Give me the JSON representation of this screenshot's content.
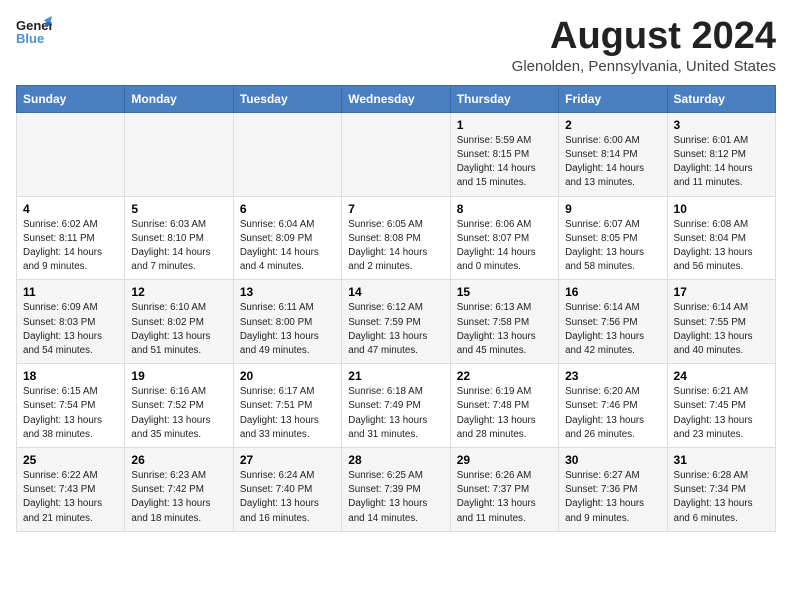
{
  "header": {
    "logo_line1": "General",
    "logo_line2": "Blue",
    "month": "August 2024",
    "location": "Glenolden, Pennsylvania, United States"
  },
  "weekdays": [
    "Sunday",
    "Monday",
    "Tuesday",
    "Wednesday",
    "Thursday",
    "Friday",
    "Saturday"
  ],
  "weeks": [
    [
      {
        "day": "",
        "info": ""
      },
      {
        "day": "",
        "info": ""
      },
      {
        "day": "",
        "info": ""
      },
      {
        "day": "",
        "info": ""
      },
      {
        "day": "1",
        "info": "Sunrise: 5:59 AM\nSunset: 8:15 PM\nDaylight: 14 hours\nand 15 minutes."
      },
      {
        "day": "2",
        "info": "Sunrise: 6:00 AM\nSunset: 8:14 PM\nDaylight: 14 hours\nand 13 minutes."
      },
      {
        "day": "3",
        "info": "Sunrise: 6:01 AM\nSunset: 8:12 PM\nDaylight: 14 hours\nand 11 minutes."
      }
    ],
    [
      {
        "day": "4",
        "info": "Sunrise: 6:02 AM\nSunset: 8:11 PM\nDaylight: 14 hours\nand 9 minutes."
      },
      {
        "day": "5",
        "info": "Sunrise: 6:03 AM\nSunset: 8:10 PM\nDaylight: 14 hours\nand 7 minutes."
      },
      {
        "day": "6",
        "info": "Sunrise: 6:04 AM\nSunset: 8:09 PM\nDaylight: 14 hours\nand 4 minutes."
      },
      {
        "day": "7",
        "info": "Sunrise: 6:05 AM\nSunset: 8:08 PM\nDaylight: 14 hours\nand 2 minutes."
      },
      {
        "day": "8",
        "info": "Sunrise: 6:06 AM\nSunset: 8:07 PM\nDaylight: 14 hours\nand 0 minutes."
      },
      {
        "day": "9",
        "info": "Sunrise: 6:07 AM\nSunset: 8:05 PM\nDaylight: 13 hours\nand 58 minutes."
      },
      {
        "day": "10",
        "info": "Sunrise: 6:08 AM\nSunset: 8:04 PM\nDaylight: 13 hours\nand 56 minutes."
      }
    ],
    [
      {
        "day": "11",
        "info": "Sunrise: 6:09 AM\nSunset: 8:03 PM\nDaylight: 13 hours\nand 54 minutes."
      },
      {
        "day": "12",
        "info": "Sunrise: 6:10 AM\nSunset: 8:02 PM\nDaylight: 13 hours\nand 51 minutes."
      },
      {
        "day": "13",
        "info": "Sunrise: 6:11 AM\nSunset: 8:00 PM\nDaylight: 13 hours\nand 49 minutes."
      },
      {
        "day": "14",
        "info": "Sunrise: 6:12 AM\nSunset: 7:59 PM\nDaylight: 13 hours\nand 47 minutes."
      },
      {
        "day": "15",
        "info": "Sunrise: 6:13 AM\nSunset: 7:58 PM\nDaylight: 13 hours\nand 45 minutes."
      },
      {
        "day": "16",
        "info": "Sunrise: 6:14 AM\nSunset: 7:56 PM\nDaylight: 13 hours\nand 42 minutes."
      },
      {
        "day": "17",
        "info": "Sunrise: 6:14 AM\nSunset: 7:55 PM\nDaylight: 13 hours\nand 40 minutes."
      }
    ],
    [
      {
        "day": "18",
        "info": "Sunrise: 6:15 AM\nSunset: 7:54 PM\nDaylight: 13 hours\nand 38 minutes."
      },
      {
        "day": "19",
        "info": "Sunrise: 6:16 AM\nSunset: 7:52 PM\nDaylight: 13 hours\nand 35 minutes."
      },
      {
        "day": "20",
        "info": "Sunrise: 6:17 AM\nSunset: 7:51 PM\nDaylight: 13 hours\nand 33 minutes."
      },
      {
        "day": "21",
        "info": "Sunrise: 6:18 AM\nSunset: 7:49 PM\nDaylight: 13 hours\nand 31 minutes."
      },
      {
        "day": "22",
        "info": "Sunrise: 6:19 AM\nSunset: 7:48 PM\nDaylight: 13 hours\nand 28 minutes."
      },
      {
        "day": "23",
        "info": "Sunrise: 6:20 AM\nSunset: 7:46 PM\nDaylight: 13 hours\nand 26 minutes."
      },
      {
        "day": "24",
        "info": "Sunrise: 6:21 AM\nSunset: 7:45 PM\nDaylight: 13 hours\nand 23 minutes."
      }
    ],
    [
      {
        "day": "25",
        "info": "Sunrise: 6:22 AM\nSunset: 7:43 PM\nDaylight: 13 hours\nand 21 minutes."
      },
      {
        "day": "26",
        "info": "Sunrise: 6:23 AM\nSunset: 7:42 PM\nDaylight: 13 hours\nand 18 minutes."
      },
      {
        "day": "27",
        "info": "Sunrise: 6:24 AM\nSunset: 7:40 PM\nDaylight: 13 hours\nand 16 minutes."
      },
      {
        "day": "28",
        "info": "Sunrise: 6:25 AM\nSunset: 7:39 PM\nDaylight: 13 hours\nand 14 minutes."
      },
      {
        "day": "29",
        "info": "Sunrise: 6:26 AM\nSunset: 7:37 PM\nDaylight: 13 hours\nand 11 minutes."
      },
      {
        "day": "30",
        "info": "Sunrise: 6:27 AM\nSunset: 7:36 PM\nDaylight: 13 hours\nand 9 minutes."
      },
      {
        "day": "31",
        "info": "Sunrise: 6:28 AM\nSunset: 7:34 PM\nDaylight: 13 hours\nand 6 minutes."
      }
    ]
  ]
}
